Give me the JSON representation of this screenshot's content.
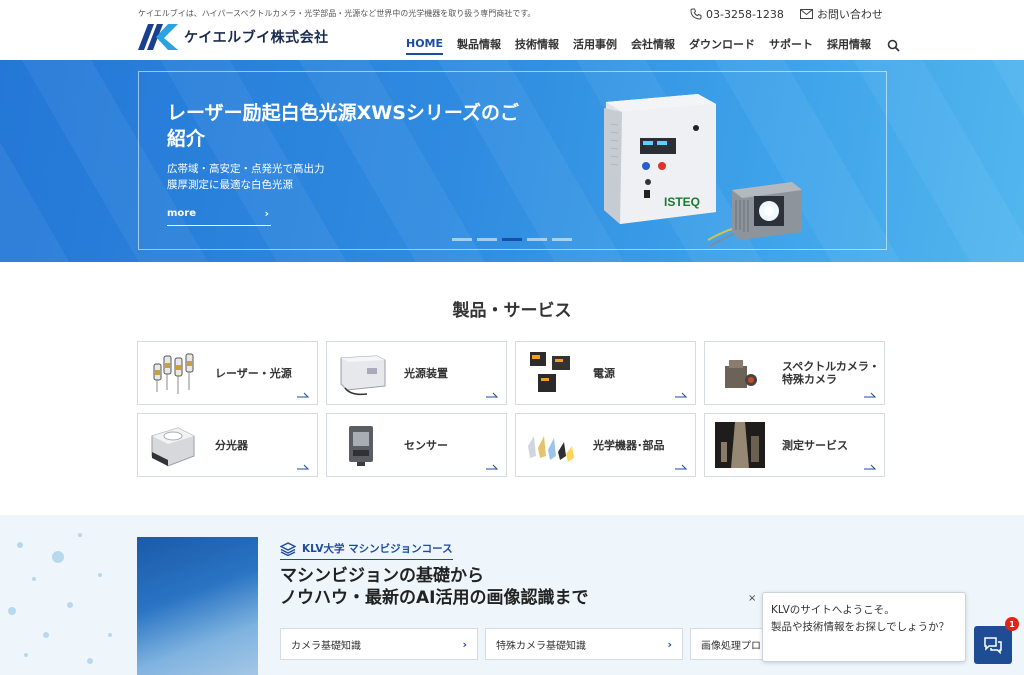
{
  "header": {
    "tagline": "ケイエルブイは、ハイパースペクトルカメラ・光学部品・光源など世界中の光学機器を取り扱う専門商社です。",
    "logo_text": "ケイエルブイ株式会社",
    "phone": "03-3258-1238",
    "contact_label": "お問い合わせ",
    "nav": [
      {
        "label": "HOME",
        "active": true
      },
      {
        "label": "製品情報"
      },
      {
        "label": "技術情報"
      },
      {
        "label": "活用事例"
      },
      {
        "label": "会社情報"
      },
      {
        "label": "ダウンロード"
      },
      {
        "label": "サポート"
      },
      {
        "label": "採用情報"
      }
    ]
  },
  "hero": {
    "title": "レーザー励起白色光源XWSシリーズのご紹介",
    "subtitle": "広帯域・高安定・点発光で高出力\n膜厚測定に最適な白色光源",
    "more_label": "more",
    "product_logo": "ISTEQ",
    "slides": 5,
    "active_slide": 3
  },
  "products": {
    "title": "製品・サービス",
    "items": [
      {
        "label": "レーザー・光源",
        "icon": "lamp-bulbs-icon"
      },
      {
        "label": "光源装置",
        "icon": "light-source-unit-icon"
      },
      {
        "label": "電源",
        "icon": "power-supply-icon"
      },
      {
        "label": "スペクトルカメラ・\n特殊カメラ",
        "icon": "spectral-camera-icon"
      },
      {
        "label": "分光器",
        "icon": "spectrometer-icon"
      },
      {
        "label": "センサー",
        "icon": "sensor-icon"
      },
      {
        "label": "光学機器･部品",
        "icon": "optical-parts-icon"
      },
      {
        "label": "測定サービス",
        "icon": "measurement-service-icon"
      }
    ]
  },
  "course": {
    "tag": "KLV大学 マシンビジョンコース",
    "title": "マシンビジョンの基礎から\nノウハウ・最新のAI活用の画像認識まで",
    "links": [
      "カメラ基礎知識",
      "特殊カメラ基礎知識",
      "画像処理プロ"
    ]
  },
  "chat": {
    "message": "KLVのサイトへようこそ。\n製品や技術情報をお探しでしょうか？",
    "close": "×",
    "badge": "1"
  },
  "colors": {
    "brand_blue": "#1d4ba0",
    "hero_blue": "#2f8be0",
    "badge_red": "#e2231a"
  }
}
